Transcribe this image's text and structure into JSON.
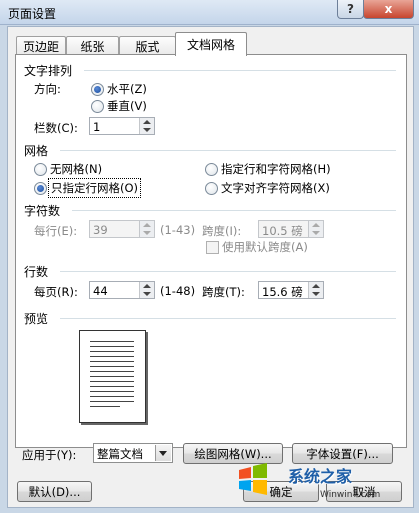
{
  "window": {
    "title": "页面设置",
    "help_glyph": "?",
    "close_glyph": "x"
  },
  "tabs": [
    {
      "label": "页边距",
      "active": false
    },
    {
      "label": "纸张",
      "active": false
    },
    {
      "label": "版式",
      "active": false
    },
    {
      "label": "文档网格",
      "active": true
    }
  ],
  "text_direction": {
    "group_label": "文字排列",
    "direction_label": "方向:",
    "horizontal": "水平(Z)",
    "vertical": "垂直(V)",
    "selected": "horizontal",
    "columns_label": "栏数(C):",
    "columns_value": "1"
  },
  "grid": {
    "group_label": "网格",
    "none": "无网格(N)",
    "lines_and_chars": "指定行和字符网格(H)",
    "lines_only": "只指定行网格(O)",
    "snap_to_chars": "文字对齐字符网格(X)",
    "selected": "lines_only"
  },
  "characters": {
    "group_label": "字符数",
    "per_line_label": "每行(E):",
    "per_line_value": "39",
    "per_line_range": "(1-43)",
    "pitch_label": "跨度(I):",
    "pitch_value": "10.5 磅",
    "use_default_label": "使用默认跨度(A)"
  },
  "lines": {
    "group_label": "行数",
    "per_page_label": "每页(R):",
    "per_page_value": "44",
    "per_page_range": "(1-48)",
    "pitch_label": "跨度(T):",
    "pitch_value": "15.6 磅"
  },
  "preview": {
    "group_label": "预览"
  },
  "apply_to": {
    "label": "应用于(Y):",
    "value": "整篇文档"
  },
  "buttons": {
    "draw_grid": "绘图网格(W)...",
    "font_settings": "字体设置(F)...",
    "default": "默认(D)...",
    "ok": "确定",
    "cancel": "取消"
  },
  "watermark": {
    "brand": "系统之家",
    "site": "Winwin7.com"
  }
}
